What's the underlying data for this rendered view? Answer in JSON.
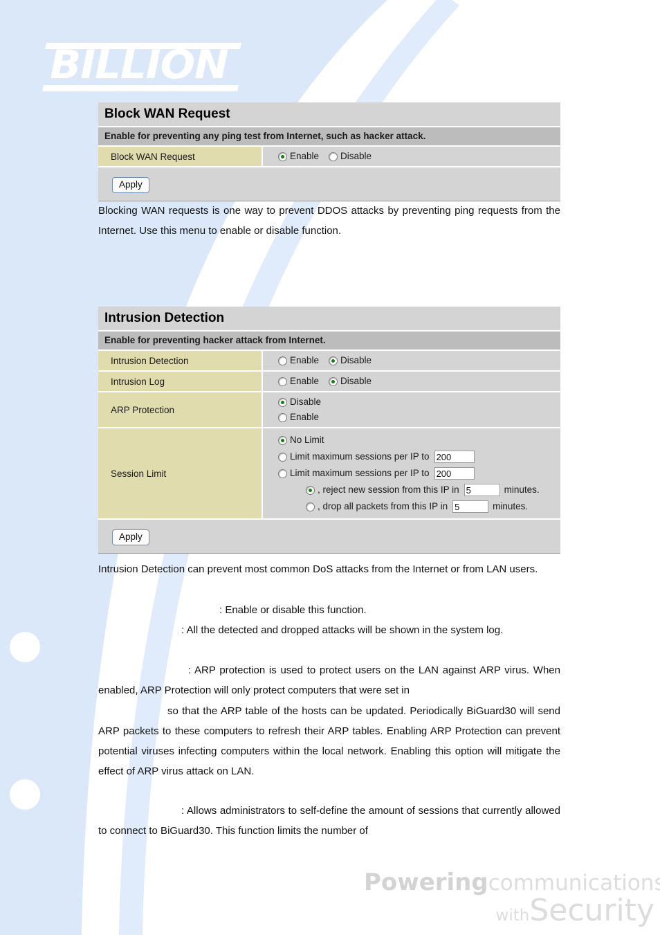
{
  "brand": {
    "logo_text": "BILLION"
  },
  "panels": [
    {
      "id": "block-wan-request",
      "title": "Block WAN Request",
      "subtitle": "Enable for preventing any ping test from Internet, such as hacker attack.",
      "rows": [
        {
          "label": "Block WAN Request",
          "options": [
            {
              "text": "Enable",
              "selected": true
            },
            {
              "text": "Disable",
              "selected": false
            }
          ]
        }
      ],
      "apply_label": "Apply"
    },
    {
      "id": "intrusion-detection",
      "title": "Intrusion Detection",
      "subtitle": "Enable for preventing hacker attack from Internet.",
      "rows": [
        {
          "label": "Intrusion Detection",
          "options": [
            {
              "text": "Enable",
              "selected": false
            },
            {
              "text": "Disable",
              "selected": true
            }
          ]
        },
        {
          "label": "Intrusion Log",
          "options": [
            {
              "text": "Enable",
              "selected": false
            },
            {
              "text": "Disable",
              "selected": true
            }
          ]
        },
        {
          "label": "ARP Protection",
          "options": [
            {
              "text": "Disable",
              "selected": true
            },
            {
              "text": "Enable",
              "selected": false
            }
          ]
        }
      ],
      "session_limit": {
        "label": "Session Limit",
        "no_limit": {
          "text": "No Limit",
          "selected": true
        },
        "limit_a": {
          "text": "Limit maximum sessions per IP to",
          "selected": false,
          "value": "200"
        },
        "limit_b": {
          "text": "Limit maximum sessions per IP to",
          "selected": false,
          "value": "200"
        },
        "reject": {
          "prefix": ", reject new session from this IP in",
          "suffix": "minutes.",
          "selected": true,
          "value": "5"
        },
        "drop": {
          "prefix": ", drop all packets from this IP in",
          "suffix": "minutes.",
          "selected": false,
          "value": "5"
        }
      },
      "apply_label": "Apply"
    }
  ],
  "body": {
    "para1": "Blocking WAN requests is one way to prevent DDOS attacks by preventing ping requests from the Internet. Use this menu to enable or disable function.",
    "para2": "Intrusion Detection can prevent most common DoS attacks from the Internet or from LAN users.",
    "para3": ": Enable or disable this function.",
    "para4": ": All the detected and dropped attacks will be shown in the system log.",
    "para5_a": ": ARP protection is used to protect users on the LAN against ARP virus. When enabled, ARP Protection will only protect computers that were set in",
    "para5_b": "so that the ARP table of the hosts can be updated. Periodically BiGuard30 will send ARP packets to these computers to refresh their ARP tables. Enabling ARP Protection can prevent potential viruses infecting computers within the local network. Enabling this option will mitigate the effect of ARP virus attack on LAN.",
    "para6": ": Allows administrators to self-define the amount of sessions that currently allowed to connect to BiGuard30. This function limits the number of"
  },
  "tagline": {
    "powering": "Powering",
    "communications": "communications",
    "with": "with",
    "security": "Security"
  },
  "colors": {
    "bg_blue": "#dae8fa",
    "panel_title_bg": "#d4d4d4",
    "panel_subtitle_bg": "#bcbcbc",
    "row_label_bg": "#e0dcae",
    "radio_dot": "#108010",
    "button_border": "#6d8fb8"
  }
}
